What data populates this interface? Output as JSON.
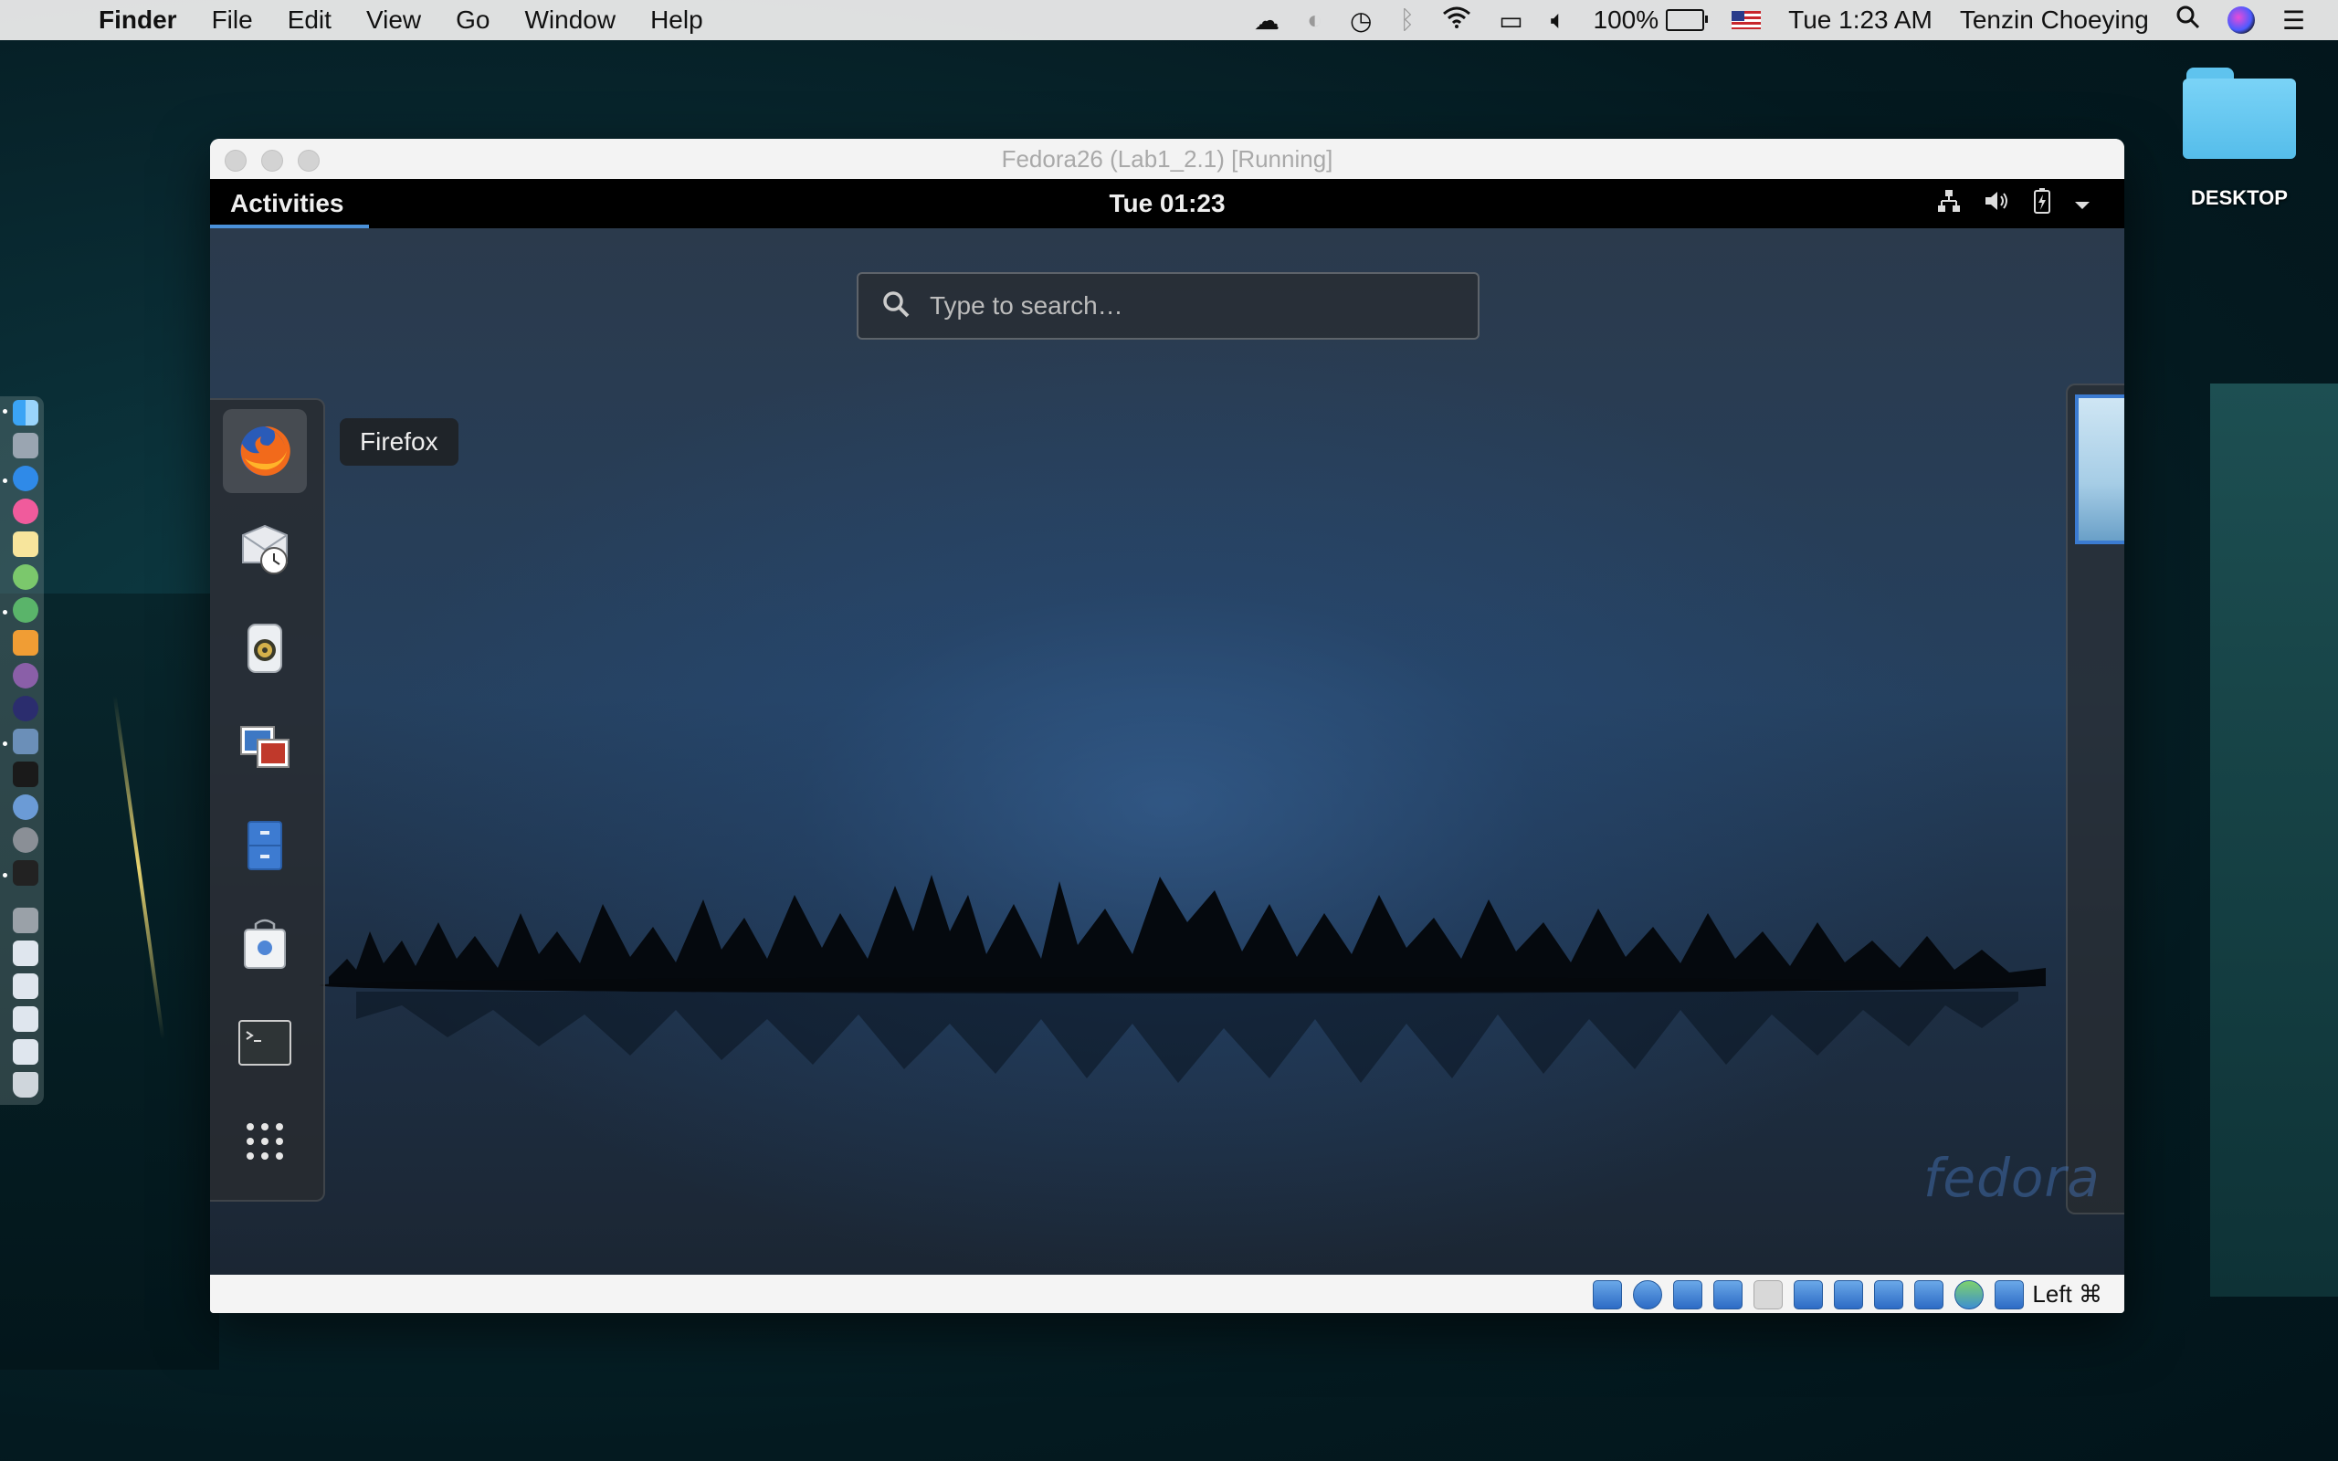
{
  "mac_menubar": {
    "app_name": "Finder",
    "menus": [
      "File",
      "Edit",
      "View",
      "Go",
      "Window",
      "Help"
    ],
    "battery_percent": "100%",
    "datetime": "Tue 1:23 AM",
    "user": "Tenzin Choeying",
    "status_icons": [
      "creative-cloud-icon",
      "sync-icon",
      "time-machine-icon",
      "bluetooth-icon",
      "wifi-icon",
      "airplay-icon",
      "volume-icon",
      "battery-icon",
      "us-flag-icon",
      "spotlight-icon",
      "siri-icon",
      "notification-center-icon"
    ]
  },
  "desktop": {
    "folder_label": "DESKTOP"
  },
  "dock": {
    "apps": [
      "Finder",
      "Launchpad",
      "Safari",
      "iTunes",
      "Notes",
      "Android File Transfer",
      "Android Studio",
      "Sublime Text",
      "GitHub Desktop",
      "Eclipse",
      "VirtualBox",
      "Kindle",
      "macOS Installer",
      "System Preferences",
      "Terminal",
      "Documents",
      "File 1",
      "File 2",
      "File 3",
      "File 4",
      "File 5",
      "Trash"
    ]
  },
  "vbox_window": {
    "title": "Fedora26 (Lab1_2.1) [Running]",
    "host_key": "Left ⌘"
  },
  "gnome": {
    "activities_label": "Activities",
    "clock": "Tue 01:23",
    "search_placeholder": "Type to search…",
    "tooltip": "Firefox",
    "dash_apps": [
      "Firefox",
      "Evolution",
      "Rhythmbox",
      "Shotwell",
      "Files",
      "Software",
      "Terminal",
      "Show Applications"
    ],
    "watermark": "fedora"
  },
  "colors": {
    "activities_underline": "#4a90d9",
    "workspace_border": "#3b7bd1",
    "desktop_folder": "#6ccbf3"
  }
}
